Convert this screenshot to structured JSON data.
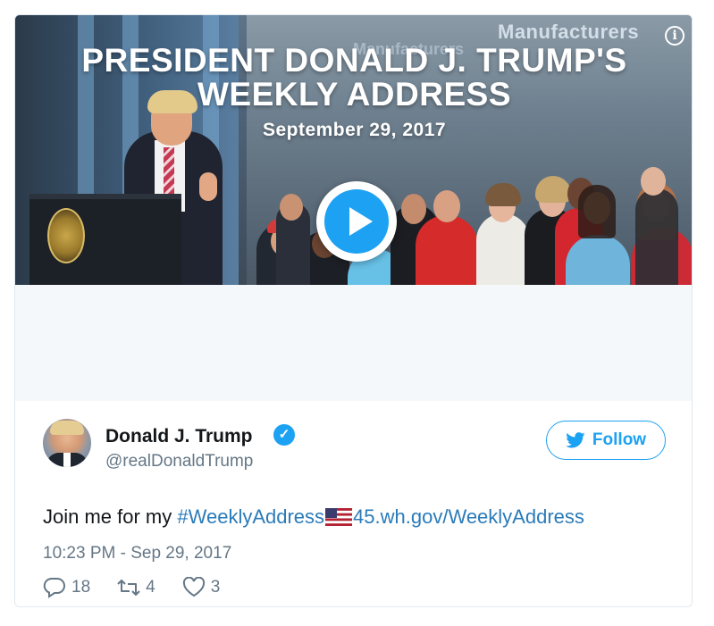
{
  "media": {
    "headline_line1": "PRESIDENT DONALD J. TRUMP'S",
    "headline_line2": "WEEKLY ADDRESS",
    "date": "September 29, 2017",
    "background_logo": "Manufacturers",
    "background_logo_sub": "Manufacturers",
    "info_icon": "info-icon",
    "play_icon": "play-icon"
  },
  "author": {
    "name": "Donald J. Trump",
    "handle": "@realDonaldTrump",
    "verified_icon": "verified-badge-icon"
  },
  "follow": {
    "label": "Follow",
    "icon": "twitter-bird-icon"
  },
  "tweet": {
    "text_prefix": "Join me for my ",
    "hashtag": "#WeeklyAddress",
    "flag_icon": "us-flag-icon",
    "link": "45.wh.gov/WeeklyAddress",
    "timestamp": "10:23 PM - Sep 29, 2017"
  },
  "actions": {
    "replies": "18",
    "retweets": "4",
    "likes": "3"
  },
  "colors": {
    "accent": "#1da1f2",
    "link": "#2b7bb9",
    "muted": "#657786",
    "text": "#14171a"
  }
}
